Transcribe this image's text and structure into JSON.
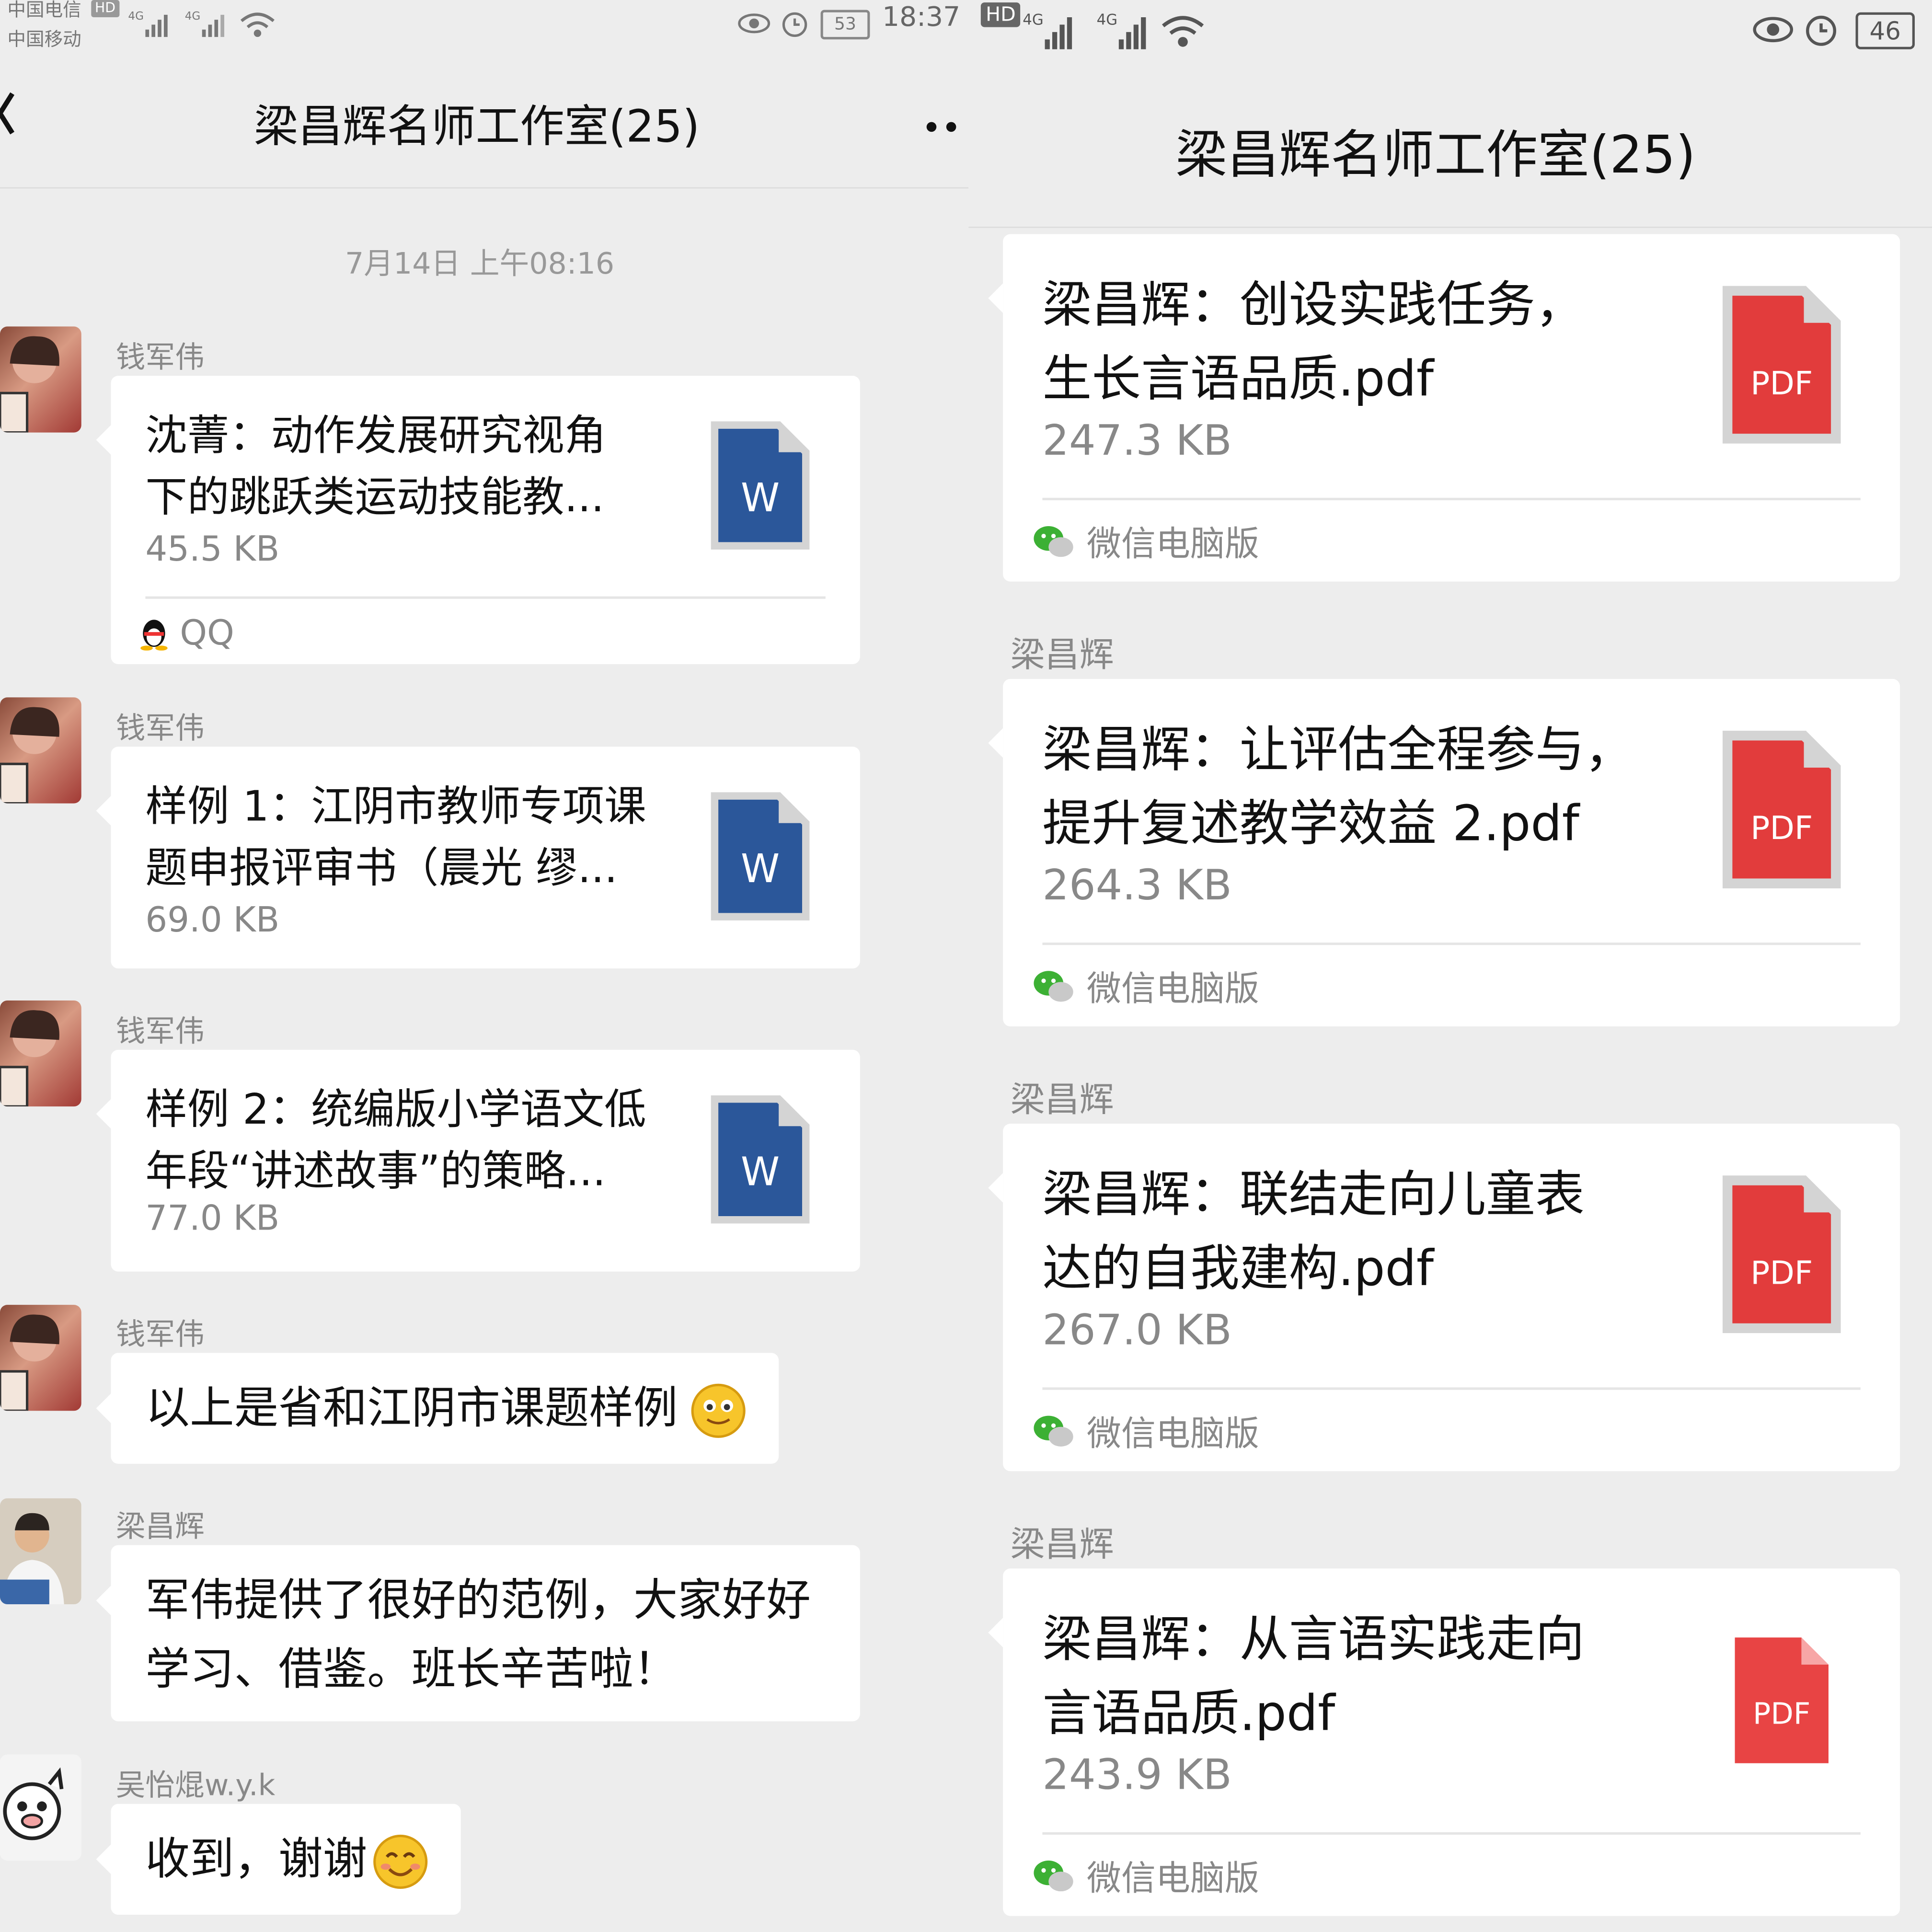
{
  "left": {
    "status": {
      "carrier1": "中国电信",
      "carrier2": "中国移动",
      "hd": "HD",
      "net1": "4G",
      "net2": "4G",
      "battery": "53",
      "time": "18:37"
    },
    "header": {
      "back_icon": "chevron-left-icon",
      "title": "梁昌辉名师工作室(25)",
      "more": "··"
    },
    "date": "7月14日 上午08:16",
    "messages": [
      {
        "sender": "钱军伟",
        "type": "file",
        "file_title": "沈菁：动作发展研究视角下的跳跃类运动技能教...",
        "file_title_l1": "沈菁：动作发展研究视角",
        "file_title_l2": "下的跳跃类运动技能教...",
        "size": "45.5 KB",
        "icon": "W",
        "source": "QQ"
      },
      {
        "sender": "钱军伟",
        "type": "file",
        "file_title_l1": "样例 1：江阴市教师专项课",
        "file_title_l2": "题申报评审书（晨光 缪...",
        "size": "69.0 KB",
        "icon": "W"
      },
      {
        "sender": "钱军伟",
        "type": "file",
        "file_title_l1": "样例 2：统编版小学语文低",
        "file_title_l2": "年段“讲述故事”的策略...",
        "size": "77.0 KB",
        "icon": "W"
      },
      {
        "sender": "钱军伟",
        "type": "text",
        "text": "以上是省和江阴市课题样例"
      },
      {
        "sender": "梁昌辉",
        "type": "text",
        "text_l1": "军伟提供了很好的范例，大家好好",
        "text_l2": "学习、借鉴。班长辛苦啦！"
      },
      {
        "sender": "吴怡焜w.y.k",
        "type": "text",
        "text": "收到，谢谢"
      }
    ]
  },
  "right": {
    "status": {
      "hd": "HD",
      "net1": "4G",
      "net2": "4G",
      "battery": "46"
    },
    "header": {
      "title": "梁昌辉名师工作室(25)"
    },
    "messages": [
      {
        "type": "file",
        "file_title_l1": "梁昌辉：创设实践任务，",
        "file_title_l2": "生长言语品质.pdf",
        "size": "247.3 KB",
        "icon": "PDF",
        "source": "微信电脑版"
      },
      {
        "sender": "梁昌辉",
        "type": "file",
        "file_title_l1": "梁昌辉：让评估全程参与，",
        "file_title_l2": "提升复述教学效益 2.pdf",
        "size": "264.3 KB",
        "icon": "PDF",
        "source": "微信电脑版"
      },
      {
        "sender": "梁昌辉",
        "type": "file",
        "file_title_l1": "梁昌辉：联结走向儿童表",
        "file_title_l2": "达的自我建构.pdf",
        "size": "267.0 KB",
        "icon": "PDF",
        "source": "微信电脑版"
      },
      {
        "sender": "梁昌辉",
        "type": "file",
        "file_title_l1": "梁昌辉：从言语实践走向",
        "file_title_l2": "言语品质.pdf",
        "size": "243.9 KB",
        "icon": "PDF",
        "source": "微信电脑版"
      }
    ]
  },
  "colors": {
    "background": "#ededed",
    "word_blue": "#2b579a",
    "pdf_red": "#e23c3c",
    "wechat_green": "#3cb034"
  }
}
